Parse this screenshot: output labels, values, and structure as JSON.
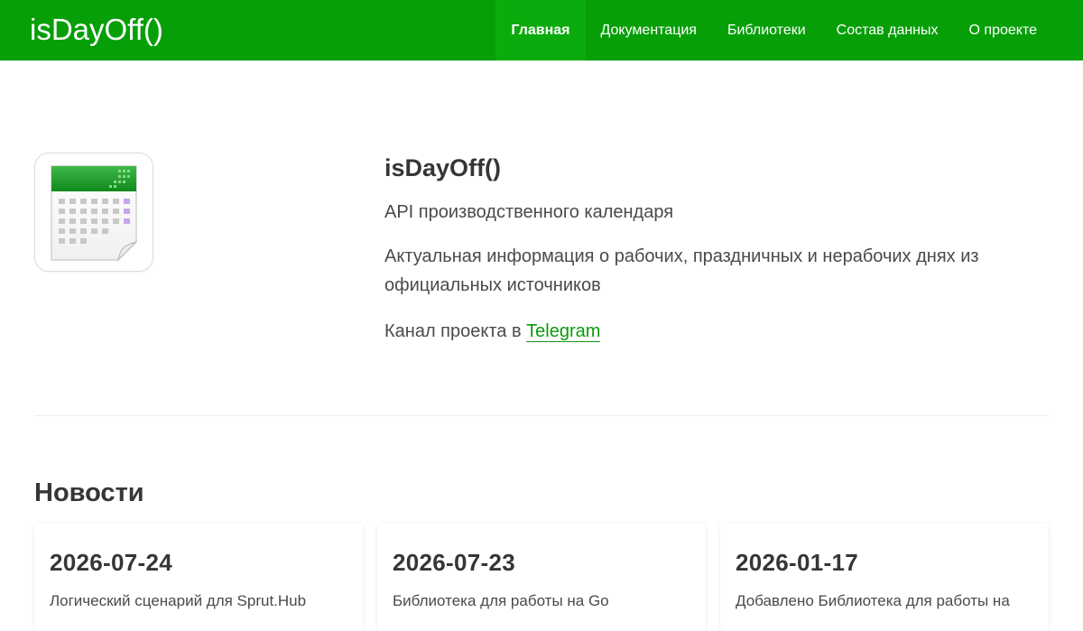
{
  "navbar": {
    "brand": "isDayOff()",
    "items": [
      {
        "label": "Главная",
        "active": true
      },
      {
        "label": "Документация",
        "active": false
      },
      {
        "label": "Библиотеки",
        "active": false
      },
      {
        "label": "Состав данных",
        "active": false
      },
      {
        "label": "О проекте",
        "active": false
      }
    ]
  },
  "hero": {
    "icon": "calendar-icon",
    "title": "isDayOff()",
    "subtitle": "API производственного календаря",
    "description": "Актуальная информация о рабочих, праздничных и нерабочих днях из официальных источников",
    "channel_prefix": "Канал проекта в ",
    "channel_link": "Telegram"
  },
  "news": {
    "heading": "Новости",
    "items": [
      {
        "date": "2026-07-24",
        "text": "Логический сценарий для Sprut.Hub"
      },
      {
        "date": "2026-07-23",
        "text": "Библиотека для работы на Go"
      },
      {
        "date": "2026-01-17",
        "text": "Добавлено Библиотека для работы на"
      }
    ]
  },
  "colors": {
    "navbar": "#079f08",
    "navbar_active": "#0cab0d",
    "link": "#0c9a0c"
  }
}
